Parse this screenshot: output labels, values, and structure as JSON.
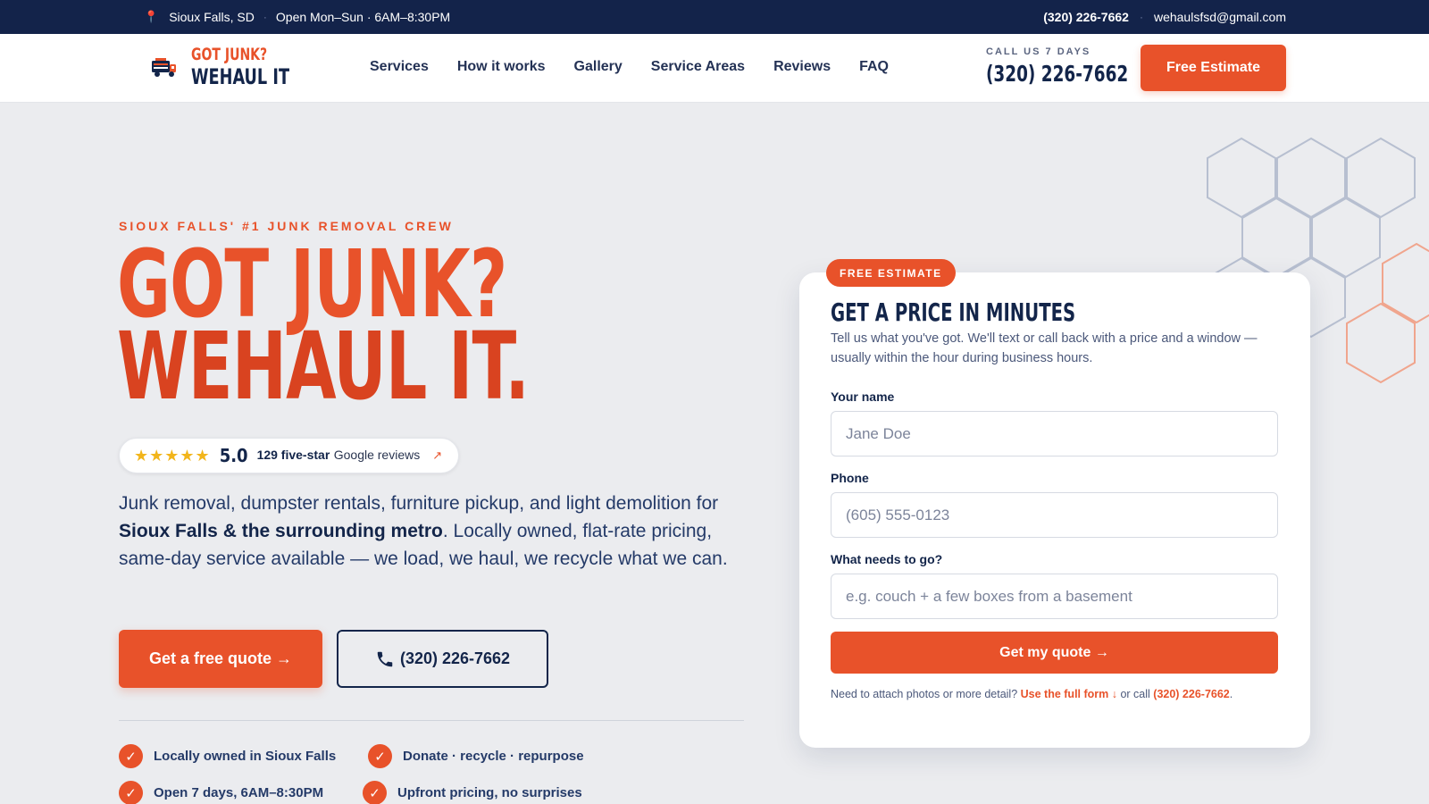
{
  "topbar": {
    "location": "Sioux Falls, SD",
    "hours": "Open Mon–Sun · 6AM–8:30PM",
    "phone": "(320) 226-7662",
    "email": "wehaulsfsd@gmail.com"
  },
  "logo": {
    "line1": "GOT JUNK?",
    "line2": "WEHAUL IT"
  },
  "nav": {
    "items": [
      "Services",
      "How it works",
      "Gallery",
      "Service Areas",
      "Reviews",
      "FAQ"
    ]
  },
  "call": {
    "caption": "CALL US 7 DAYS",
    "phone": "(320) 226-7662"
  },
  "header_cta": "Free Estimate",
  "hero": {
    "eyebrow": "SIOUX FALLS' #1 JUNK REMOVAL CREW",
    "headline_1": "GOT JUNK?",
    "headline_2": "WEHAUL IT.",
    "rating": {
      "stars": "★★★★★",
      "score": "5.0",
      "count": "129 five-star",
      "source": "Google reviews",
      "arrow": "↗"
    },
    "desc_1": "Junk removal, dumpster rentals, furniture pickup, and light demolition for ",
    "desc_bold": "Sioux Falls & the surrounding metro",
    "desc_2": ". Locally owned, flat-rate pricing, same-day service available — we load, we haul, we recycle what we can.",
    "cta_primary": "Get a free quote →",
    "cta_phone": "(320) 226-7662",
    "features": [
      "Locally owned in Sioux Falls",
      "Donate · recycle · repurpose",
      "Open 7 days, 6AM–8:30PM",
      "Upfront pricing, no surprises"
    ]
  },
  "form": {
    "badge": "FREE ESTIMATE",
    "title": "GET A PRICE IN MINUTES",
    "subtitle": "Tell us what you've got. We'll text or call back with a price and a window — usually within the hour during business hours.",
    "name_label": "Your name",
    "name_placeholder": "Jane Doe",
    "phone_label": "Phone",
    "phone_placeholder": "(605) 555-0123",
    "items_label": "What needs to go?",
    "items_placeholder": "e.g. couch + a few boxes from a basement",
    "submit": "Get my quote →",
    "footer_1": "Need to attach photos or more detail? ",
    "footer_link": "Use the full form ↓",
    "footer_2": " or call ",
    "footer_phone": "(320) 226-7662",
    "footer_end": "."
  },
  "colors": {
    "navy": "#13234a",
    "accent": "#e8522a",
    "background": "#ebecef"
  }
}
